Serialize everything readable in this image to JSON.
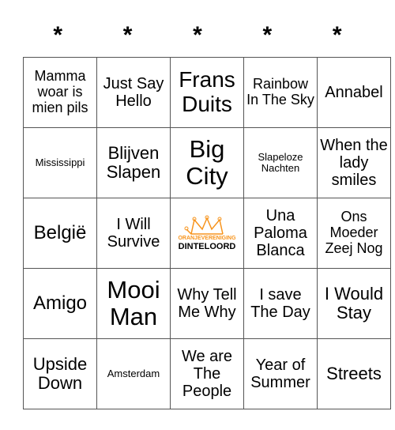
{
  "header": [
    "*",
    "*",
    "*",
    "*",
    "*"
  ],
  "rows": [
    [
      {
        "text": "Mamma woar is mien pils",
        "size": "s18"
      },
      {
        "text": "Just Say Hello",
        "size": "s20"
      },
      {
        "text": "Frans Duits",
        "size": "s28"
      },
      {
        "text": "Rainbow In The Sky",
        "size": "s18"
      },
      {
        "text": "Annabel",
        "size": "s20"
      }
    ],
    [
      {
        "text": "Mississippi",
        "size": "s13"
      },
      {
        "text": "Blijven Slapen",
        "size": "s22"
      },
      {
        "text": "Big City",
        "size": "s30"
      },
      {
        "text": "Slapeloze Nachten",
        "size": "s13"
      },
      {
        "text": "When the lady smiles",
        "size": "s20"
      }
    ],
    [
      {
        "text": "België",
        "size": "s24"
      },
      {
        "text": "I Will Survive",
        "size": "s20"
      },
      {
        "free": true,
        "logo_top": "ORANJEVERENIGING",
        "logo_bottom": "DINTELOORD"
      },
      {
        "text": "Una Paloma Blanca",
        "size": "s20"
      },
      {
        "text": "Ons Moeder Zeej Nog",
        "size": "s18"
      }
    ],
    [
      {
        "text": "Amigo",
        "size": "s24"
      },
      {
        "text": "Mooi Man",
        "size": "s30"
      },
      {
        "text": "Why Tell Me Why",
        "size": "s20"
      },
      {
        "text": "I save The Day",
        "size": "s20"
      },
      {
        "text": "I Would Stay",
        "size": "s22"
      }
    ],
    [
      {
        "text": "Upside Down",
        "size": "s22"
      },
      {
        "text": "Amsterdam",
        "size": "s13"
      },
      {
        "text": "We are The People",
        "size": "s20"
      },
      {
        "text": "Year of Summer",
        "size": "s20"
      },
      {
        "text": "Streets",
        "size": "s22"
      }
    ]
  ],
  "colors": {
    "logo_orange": "#f7941d"
  }
}
